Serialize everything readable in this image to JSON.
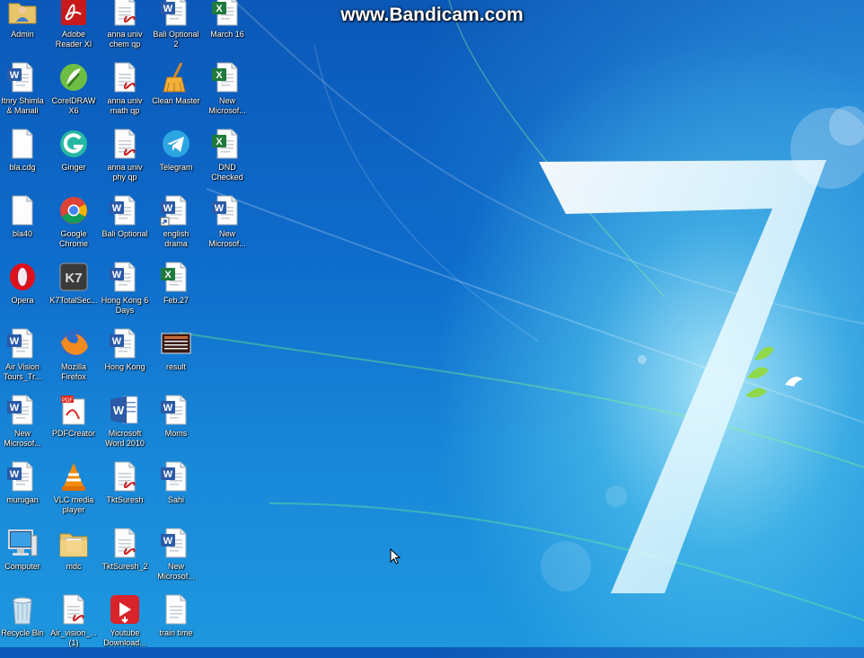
{
  "watermark": "www.Bandicam.com",
  "colors": {
    "wallpaper_dark": "#0b58b8",
    "wallpaper_light": "#bff5ff",
    "word": "#2b5aa8",
    "excel": "#1f7a3c",
    "pdf": "#c8191b"
  },
  "icons": [
    {
      "label": "Admin",
      "icon": "user-folder-icon",
      "col": 0,
      "row": 0
    },
    {
      "label": "Adobe\nReader XI",
      "icon": "adobe-reader-icon",
      "col": 1,
      "row": 0
    },
    {
      "label": "anna univ\nchem qp",
      "icon": "pdf-document-icon",
      "col": 2,
      "row": 0
    },
    {
      "label": "Bali Optional\n2",
      "icon": "word-document-icon",
      "col": 3,
      "row": 0
    },
    {
      "label": "March 16",
      "icon": "excel-document-icon",
      "col": 4,
      "row": 0
    },
    {
      "label": "Itnry Shimla\n& Manali",
      "icon": "word-document-icon",
      "col": 0,
      "row": 1
    },
    {
      "label": "CorelDRAW\nX6",
      "icon": "coreldraw-icon",
      "col": 1,
      "row": 1
    },
    {
      "label": "anna univ\nmath qp",
      "icon": "pdf-document-icon",
      "col": 2,
      "row": 1
    },
    {
      "label": "Clean Master",
      "icon": "broom-icon",
      "col": 3,
      "row": 1
    },
    {
      "label": "New\nMicrosof...",
      "icon": "excel-document-icon",
      "col": 4,
      "row": 1
    },
    {
      "label": "bla.cdg",
      "icon": "blank-file-icon",
      "col": 0,
      "row": 2
    },
    {
      "label": "Ginger",
      "icon": "ginger-icon",
      "col": 1,
      "row": 2
    },
    {
      "label": "anna univ\nphy qp",
      "icon": "pdf-document-icon",
      "col": 2,
      "row": 2
    },
    {
      "label": "Telegram",
      "icon": "telegram-icon",
      "col": 3,
      "row": 2
    },
    {
      "label": "DND\nChecked",
      "icon": "excel-document-icon",
      "col": 4,
      "row": 2
    },
    {
      "label": "bla40",
      "icon": "blank-file-icon",
      "col": 0,
      "row": 3
    },
    {
      "label": "Google\nChrome",
      "icon": "chrome-icon",
      "col": 1,
      "row": 3
    },
    {
      "label": "Bali Optional",
      "icon": "word-document-icon",
      "col": 2,
      "row": 3
    },
    {
      "label": "english\ndrama",
      "icon": "word-shortcut-icon",
      "col": 3,
      "row": 3
    },
    {
      "label": "New\nMicrosof...",
      "icon": "word-document-icon",
      "col": 4,
      "row": 3
    },
    {
      "label": "Opera",
      "icon": "opera-icon",
      "col": 0,
      "row": 4
    },
    {
      "label": "K7TotalSec...",
      "icon": "k7-icon",
      "col": 1,
      "row": 4
    },
    {
      "label": "Hong Kong 6\nDays",
      "icon": "word-document-icon",
      "col": 2,
      "row": 4
    },
    {
      "label": "Feb.27",
      "icon": "excel-document-icon",
      "col": 3,
      "row": 4
    },
    {
      "label": "Air Vision\nTours_Tr...",
      "icon": "word-document-icon",
      "col": 0,
      "row": 5
    },
    {
      "label": "Mozilla\nFirefox",
      "icon": "firefox-icon",
      "col": 1,
      "row": 5
    },
    {
      "label": "Hong Kong",
      "icon": "word-document-icon",
      "col": 2,
      "row": 5
    },
    {
      "label": "result",
      "icon": "image-file-icon",
      "col": 3,
      "row": 5
    },
    {
      "label": "New\nMicrosof...",
      "icon": "word-document-icon",
      "col": 0,
      "row": 6
    },
    {
      "label": "PDFCreator",
      "icon": "pdfcreator-icon",
      "col": 1,
      "row": 6
    },
    {
      "label": "Microsoft\nWord 2010",
      "icon": "word-app-icon",
      "col": 2,
      "row": 6
    },
    {
      "label": "Moms",
      "icon": "word-document-icon",
      "col": 3,
      "row": 6
    },
    {
      "label": "murugan",
      "icon": "word-document-icon",
      "col": 0,
      "row": 7
    },
    {
      "label": "VLC media\nplayer",
      "icon": "vlc-icon",
      "col": 1,
      "row": 7
    },
    {
      "label": "TktSuresh",
      "icon": "pdf-document-icon",
      "col": 2,
      "row": 7
    },
    {
      "label": "Sahi",
      "icon": "word-document-icon",
      "col": 3,
      "row": 7
    },
    {
      "label": "Computer",
      "icon": "computer-icon",
      "col": 0,
      "row": 8
    },
    {
      "label": "mdc",
      "icon": "folder-icon",
      "col": 1,
      "row": 8
    },
    {
      "label": "TktSuresh_2",
      "icon": "pdf-document-icon",
      "col": 2,
      "row": 8
    },
    {
      "label": "New\nMicrosof...",
      "icon": "word-document-icon",
      "col": 3,
      "row": 8
    },
    {
      "label": "Recycle Bin",
      "icon": "recycle-bin-icon",
      "col": 0,
      "row": 9
    },
    {
      "label": "Air_vision_...\n(1)",
      "icon": "pdf-document-icon",
      "col": 1,
      "row": 9
    },
    {
      "label": "Youtube\nDownload...",
      "icon": "youtube-downloader-icon",
      "col": 2,
      "row": 9
    },
    {
      "label": "train time",
      "icon": "text-file-icon",
      "col": 3,
      "row": 9
    }
  ]
}
